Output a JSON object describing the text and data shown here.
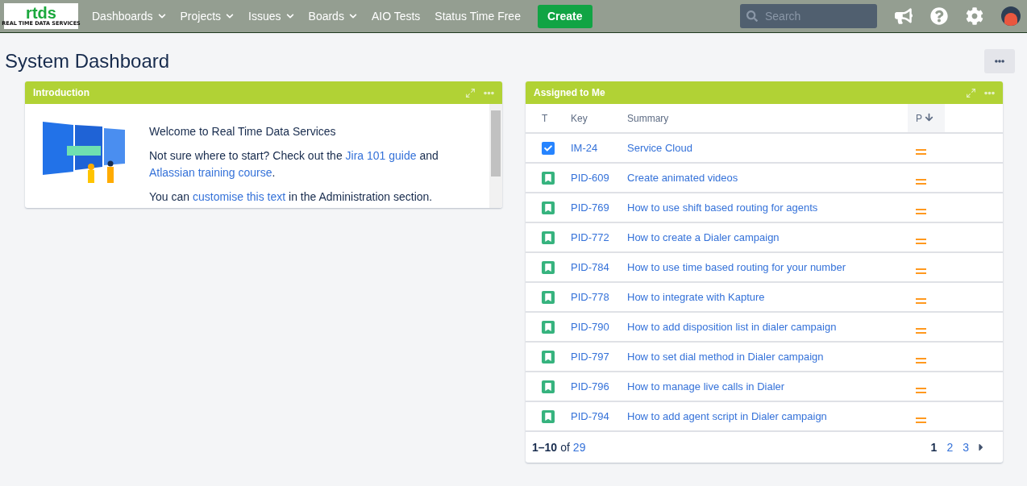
{
  "logo": {
    "mark": "rtds",
    "tagline": "REAL TIME DATA SERVICES"
  },
  "nav": [
    {
      "label": "Dashboards",
      "dropdown": true
    },
    {
      "label": "Projects",
      "dropdown": true
    },
    {
      "label": "Issues",
      "dropdown": true
    },
    {
      "label": "Boards",
      "dropdown": true
    },
    {
      "label": "AIO Tests",
      "dropdown": false
    },
    {
      "label": "Status Time Free",
      "dropdown": false
    }
  ],
  "create_button": "Create",
  "search": {
    "placeholder": "Search"
  },
  "page_title": "System Dashboard",
  "intro_gadget": {
    "title": "Introduction",
    "paragraphs": [
      [
        {
          "text": "Welcome to Real Time Data Services",
          "kind": "text"
        }
      ],
      [
        {
          "text": "Not sure where to start? Check out the ",
          "kind": "text"
        },
        {
          "text": "Jira 101 guide",
          "kind": "link"
        },
        {
          "text": " and ",
          "kind": "text"
        },
        {
          "text": "Atlassian training course",
          "kind": "link"
        },
        {
          "text": ".",
          "kind": "text"
        }
      ],
      [
        {
          "text": "You can ",
          "kind": "text"
        },
        {
          "text": "customise this text",
          "kind": "link"
        },
        {
          "text": " in the Administration section.",
          "kind": "text"
        }
      ]
    ]
  },
  "assigned_gadget": {
    "title": "Assigned to Me",
    "columns": [
      "T",
      "Key",
      "Summary",
      "P"
    ],
    "rows": [
      {
        "kind": "task",
        "key": "IM-24",
        "summary": "Service Cloud"
      },
      {
        "kind": "story",
        "key": "PID-609",
        "summary": "Create animated videos"
      },
      {
        "kind": "story",
        "key": "PID-769",
        "summary": "How to use shift based routing for agents"
      },
      {
        "kind": "story",
        "key": "PID-772",
        "summary": "How to create a Dialer campaign"
      },
      {
        "kind": "story",
        "key": "PID-784",
        "summary": "How to use time based routing for your number"
      },
      {
        "kind": "story",
        "key": "PID-778",
        "summary": "How to integrate with Kapture"
      },
      {
        "kind": "story",
        "key": "PID-790",
        "summary": "How to add disposition list in dialer campaign"
      },
      {
        "kind": "story",
        "key": "PID-797",
        "summary": "How to set dial method in Dialer campaign"
      },
      {
        "kind": "story",
        "key": "PID-796",
        "summary": "How to manage live calls in Dialer"
      },
      {
        "kind": "story",
        "key": "PID-794",
        "summary": "How to add agent script in Dialer campaign"
      }
    ],
    "range": "1–10",
    "of": "of",
    "total": "29",
    "pages": [
      {
        "label": "1",
        "selected": true
      },
      {
        "label": "2",
        "selected": false
      },
      {
        "label": "3",
        "selected": false
      }
    ]
  }
}
